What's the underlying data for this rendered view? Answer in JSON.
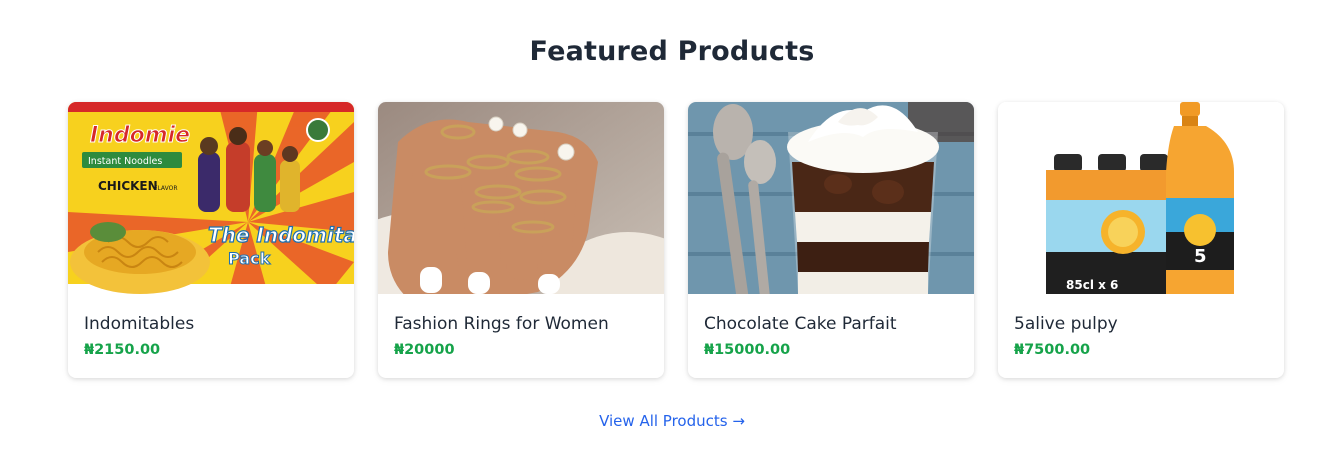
{
  "section": {
    "title": "Featured Products",
    "view_all_label": "View All Products →"
  },
  "products": [
    {
      "name": "Indomitables",
      "price": "₦2150.00",
      "image": "indomie-noodles-pack-image",
      "pack_text": "Indomie",
      "pack_sub": "Instant Noodles",
      "pack_flavor": "CHICKEN",
      "pack_flavor_sub": "FLAVOR",
      "pack_title": "The Indomitables",
      "pack_title2": "Pack"
    },
    {
      "name": "Fashion Rings for Women",
      "price": "₦20000",
      "image": "hand-with-rings-image"
    },
    {
      "name": "Chocolate Cake Parfait",
      "price": "₦15000.00",
      "image": "chocolate-parfait-image"
    },
    {
      "name": "5alive pulpy",
      "price": "₦7500.00",
      "image": "juice-bottles-image",
      "bottle_label": "85cl x 6",
      "brand_mark": "5"
    }
  ],
  "colors": {
    "title": "#1f2937",
    "price": "#16a34a",
    "link": "#2563eb"
  }
}
